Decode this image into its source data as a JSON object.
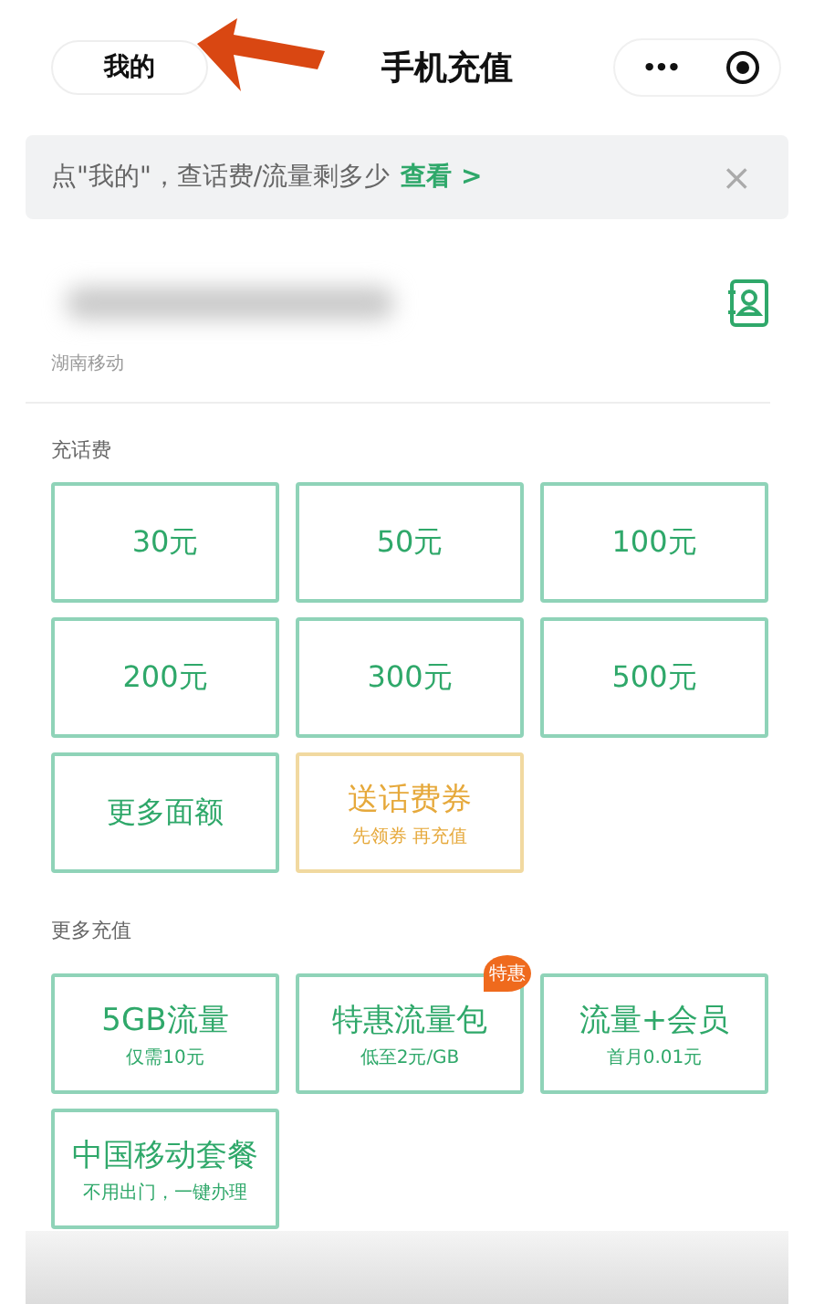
{
  "nav": {
    "back_button": "我的",
    "title": "手机充值",
    "more": "•••"
  },
  "notice": {
    "text": "点\"我的\"，查话费/流量剩多少",
    "link": "查看 >",
    "close": "×"
  },
  "account": {
    "carrier": "湖南移动"
  },
  "recharge": {
    "heading": "充话费",
    "options": [
      {
        "kind": "amount",
        "label": "30元"
      },
      {
        "kind": "amount",
        "label": "50元"
      },
      {
        "kind": "amount",
        "label": "100元"
      },
      {
        "kind": "amount",
        "label": "200元"
      },
      {
        "kind": "amount",
        "label": "300元"
      },
      {
        "kind": "amount",
        "label": "500元"
      },
      {
        "kind": "amount",
        "label": "更多面额"
      },
      {
        "kind": "coupon",
        "label": "送话费券",
        "sub": "先领券 再充值"
      }
    ]
  },
  "more": {
    "heading": "更多充值",
    "options": [
      {
        "label": "5GB流量",
        "sub": "仅需10元"
      },
      {
        "label": "特惠流量包",
        "sub": "低至2元/GB",
        "badge": "特惠"
      },
      {
        "label": "流量+会员",
        "sub": "首月0.01元"
      },
      {
        "label": "中国移动套餐",
        "sub": "不用出门，一键办理"
      }
    ]
  }
}
